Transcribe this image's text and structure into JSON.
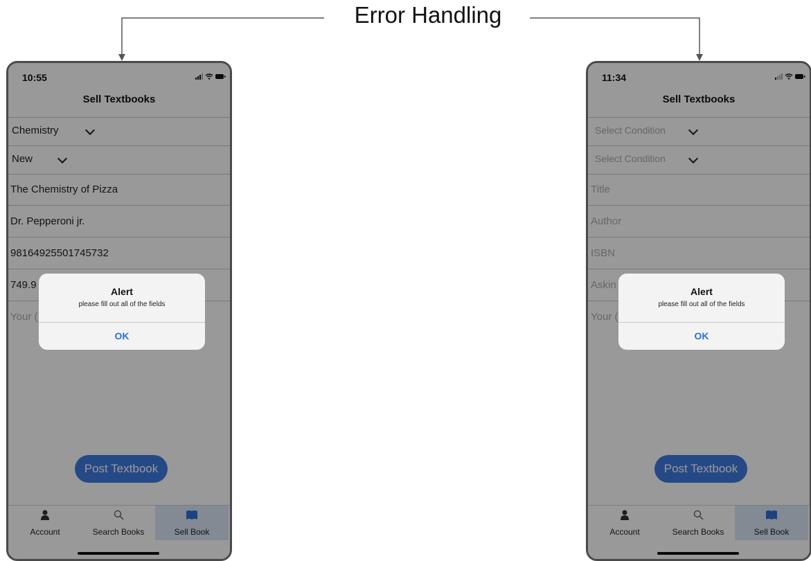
{
  "heading": "Error Handling",
  "screens": {
    "left": {
      "time": "10:55",
      "title": "Sell Textbooks",
      "subject": "Chemistry",
      "condition": "New",
      "title_value": "The Chemistry of Pizza",
      "author_value": "Dr. Pepperoni jr.",
      "isbn_value": "98164925501745732",
      "price_value": "749.9",
      "contact_value": "Your (",
      "post_button": "Post Textbook",
      "alert": {
        "title": "Alert",
        "message": "please fill out all of the fields",
        "ok": "OK"
      },
      "tabs": [
        "Account",
        "Search Books",
        "Sell Book"
      ]
    },
    "right": {
      "time": "11:34",
      "title": "Sell Textbooks",
      "subject_placeholder": "Select Condition",
      "condition_placeholder": "Select Condition",
      "title_placeholder": "Title",
      "author_placeholder": "Author",
      "isbn_placeholder": "ISBN",
      "price_placeholder": "Askin",
      "contact_placeholder": "Your (",
      "post_button": "Post Textbook",
      "alert": {
        "title": "Alert",
        "message": "please fill out all of the fields",
        "ok": "OK"
      },
      "tabs": [
        "Account",
        "Search Books",
        "Sell Book"
      ]
    }
  },
  "colors": {
    "accent": "#3f7be0",
    "ok_text": "#2f6fd6",
    "active_tab": "#dbe6f7"
  },
  "icons": [
    "person-icon",
    "search-icon",
    "book-icon",
    "chevron-down-icon",
    "signal-icon",
    "wifi-icon",
    "battery-icon"
  ]
}
